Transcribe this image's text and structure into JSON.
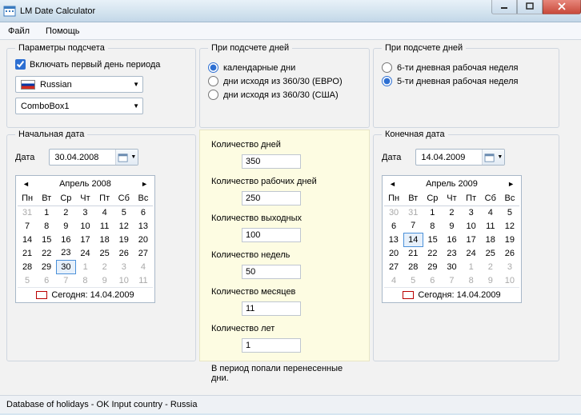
{
  "window": {
    "title": "LM Date Calculator"
  },
  "menu": {
    "file": "Файл",
    "help": "Помощь"
  },
  "params": {
    "legend": "Параметры подсчета",
    "include_first_day": "Включать первый день периода",
    "language_combo": "Russian",
    "combo2": "ComboBox1"
  },
  "daycount1": {
    "legend": "При подсчете дней",
    "opt_calendar": "календарные дни",
    "opt_360_euro": "дни исходя из 360/30 (ЕВРО)",
    "opt_360_usa": "дни исходя из 360/30 (США)"
  },
  "daycount2": {
    "legend": "При подсчете дней",
    "opt_6day": "6-ти дневная рабочая неделя",
    "opt_5day": "5-ти дневная рабочая неделя"
  },
  "start": {
    "legend": "Начальная дата",
    "label": "Дата",
    "value": "30.04.2008",
    "cal": {
      "header": "Апрель 2008",
      "dh": [
        "Пн",
        "Вт",
        "Ср",
        "Чт",
        "Пт",
        "Сб",
        "Вс"
      ],
      "rows": [
        [
          {
            "d": "31",
            "dim": true
          },
          {
            "d": "1"
          },
          {
            "d": "2"
          },
          {
            "d": "3"
          },
          {
            "d": "4"
          },
          {
            "d": "5"
          },
          {
            "d": "6"
          }
        ],
        [
          {
            "d": "7"
          },
          {
            "d": "8"
          },
          {
            "d": "9"
          },
          {
            "d": "10"
          },
          {
            "d": "11"
          },
          {
            "d": "12"
          },
          {
            "d": "13"
          }
        ],
        [
          {
            "d": "14"
          },
          {
            "d": "15"
          },
          {
            "d": "16"
          },
          {
            "d": "17"
          },
          {
            "d": "18"
          },
          {
            "d": "19"
          },
          {
            "d": "20"
          }
        ],
        [
          {
            "d": "21"
          },
          {
            "d": "22"
          },
          {
            "d": "23"
          },
          {
            "d": "24"
          },
          {
            "d": "25"
          },
          {
            "d": "26"
          },
          {
            "d": "27"
          }
        ],
        [
          {
            "d": "28"
          },
          {
            "d": "29"
          },
          {
            "d": "30",
            "sel": true
          },
          {
            "d": "1",
            "dim": true
          },
          {
            "d": "2",
            "dim": true
          },
          {
            "d": "3",
            "dim": true
          },
          {
            "d": "4",
            "dim": true
          }
        ],
        [
          {
            "d": "5",
            "dim": true
          },
          {
            "d": "6",
            "dim": true
          },
          {
            "d": "7",
            "dim": true
          },
          {
            "d": "8",
            "dim": true
          },
          {
            "d": "9",
            "dim": true
          },
          {
            "d": "10",
            "dim": true
          },
          {
            "d": "11",
            "dim": true
          }
        ]
      ],
      "today": "Сегодня: 14.04.2009"
    }
  },
  "end": {
    "legend": "Конечная дата",
    "label": "Дата",
    "value": "14.04.2009",
    "cal": {
      "header": "Апрель 2009",
      "dh": [
        "Пн",
        "Вт",
        "Ср",
        "Чт",
        "Пт",
        "Сб",
        "Вс"
      ],
      "rows": [
        [
          {
            "d": "30",
            "dim": true
          },
          {
            "d": "31",
            "dim": true
          },
          {
            "d": "1"
          },
          {
            "d": "2"
          },
          {
            "d": "3"
          },
          {
            "d": "4"
          },
          {
            "d": "5"
          }
        ],
        [
          {
            "d": "6"
          },
          {
            "d": "7"
          },
          {
            "d": "8"
          },
          {
            "d": "9"
          },
          {
            "d": "10"
          },
          {
            "d": "11"
          },
          {
            "d": "12"
          }
        ],
        [
          {
            "d": "13"
          },
          {
            "d": "14",
            "today": true,
            "sel": true
          },
          {
            "d": "15"
          },
          {
            "d": "16"
          },
          {
            "d": "17"
          },
          {
            "d": "18"
          },
          {
            "d": "19"
          }
        ],
        [
          {
            "d": "20"
          },
          {
            "d": "21"
          },
          {
            "d": "22"
          },
          {
            "d": "23"
          },
          {
            "d": "24"
          },
          {
            "d": "25"
          },
          {
            "d": "26"
          }
        ],
        [
          {
            "d": "27"
          },
          {
            "d": "28"
          },
          {
            "d": "29"
          },
          {
            "d": "30"
          },
          {
            "d": "1",
            "dim": true
          },
          {
            "d": "2",
            "dim": true
          },
          {
            "d": "3",
            "dim": true
          }
        ],
        [
          {
            "d": "4",
            "dim": true
          },
          {
            "d": "5",
            "dim": true
          },
          {
            "d": "6",
            "dim": true
          },
          {
            "d": "7",
            "dim": true
          },
          {
            "d": "8",
            "dim": true
          },
          {
            "d": "9",
            "dim": true
          },
          {
            "d": "10",
            "dim": true
          }
        ]
      ],
      "today": "Сегодня: 14.04.2009"
    }
  },
  "results": {
    "days_label": "Количество дней",
    "days": "350",
    "workdays_label": "Количество рабочих дней",
    "workdays": "250",
    "weekends_label": "Количество выходных",
    "weekends": "100",
    "weeks_label": "Количество недель",
    "weeks": "50",
    "months_label": "Количество месяцев",
    "months": "11",
    "years_label": "Количество лет",
    "years": "1",
    "note": "В период попали перенесенные дни."
  },
  "status": "Database of holidays - OK Input country - Russia"
}
